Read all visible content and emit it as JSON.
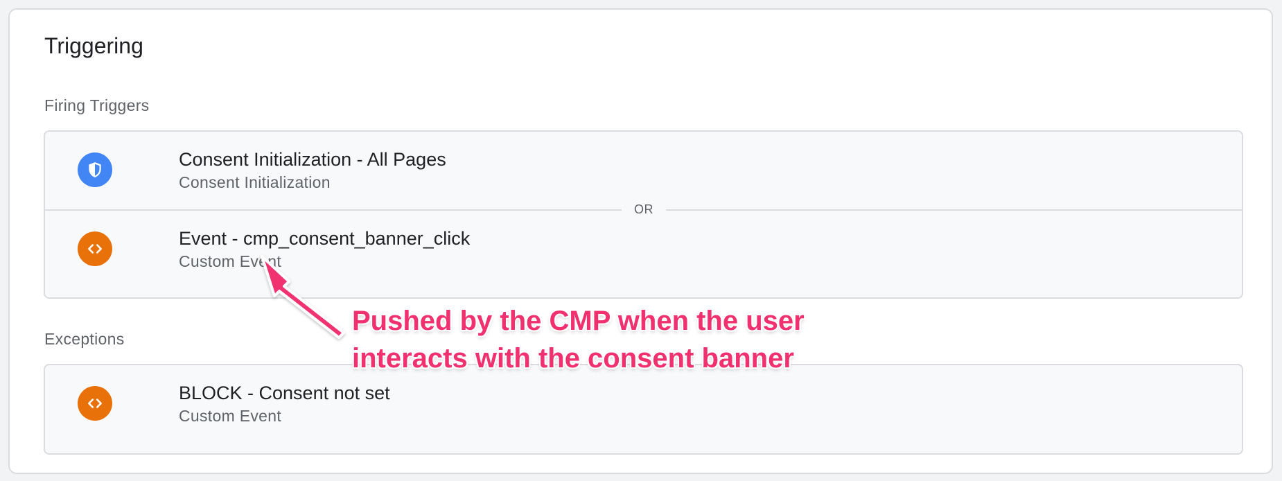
{
  "card": {
    "title": "Triggering"
  },
  "firing": {
    "label": "Firing Triggers",
    "separator": "OR",
    "items": [
      {
        "name": "Consent Initialization - All Pages",
        "type": "Consent Initialization",
        "icon": "shield-icon",
        "color": "#4285f4"
      },
      {
        "name": "Event - cmp_consent_banner_click",
        "type": "Custom Event",
        "icon": "code-icon",
        "color": "#e8710a"
      }
    ]
  },
  "exceptions": {
    "label": "Exceptions",
    "items": [
      {
        "name": "BLOCK - Consent not set",
        "type": "Custom Event",
        "icon": "code-icon",
        "color": "#e8710a"
      }
    ]
  },
  "annotation": {
    "line1": "Pushed by the CMP when the user",
    "line2": "interacts with the consent banner",
    "color": "#f0306f"
  }
}
